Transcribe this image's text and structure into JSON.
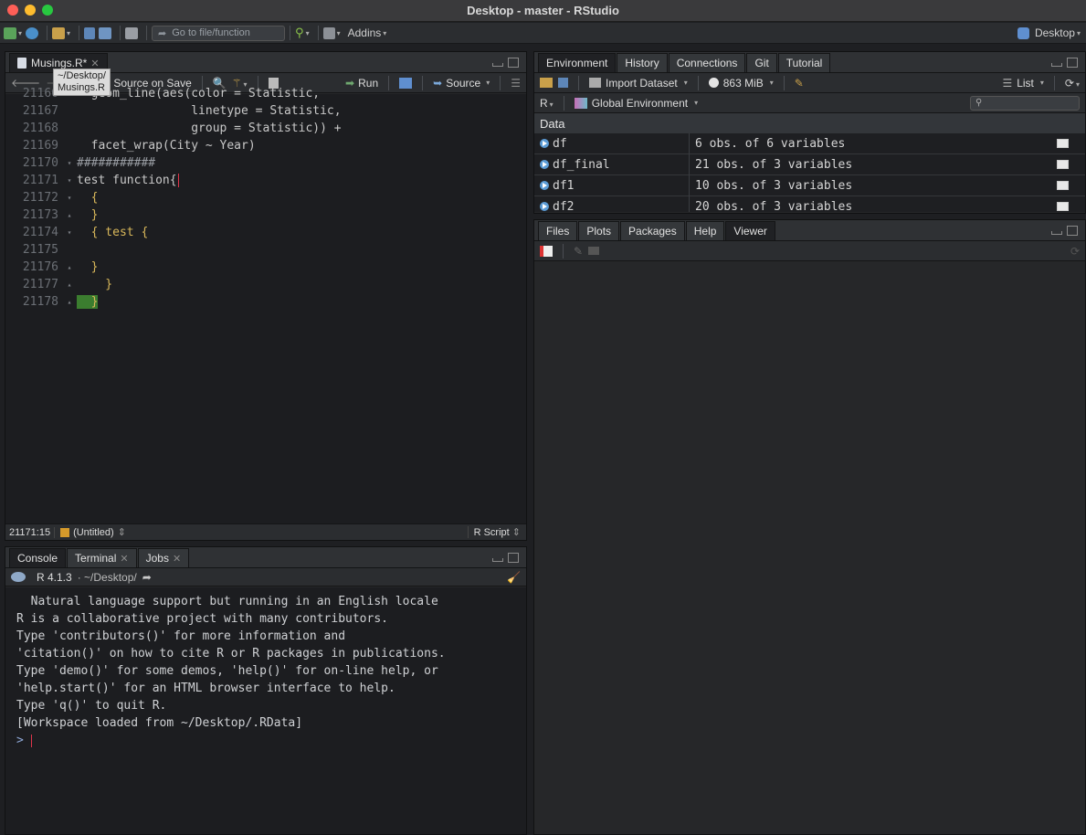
{
  "window": {
    "title": "Desktop - master - RStudio"
  },
  "toolbar": {
    "goto_placeholder": "Go to file/function",
    "addins_label": "Addins",
    "project_label": "Desktop"
  },
  "source_pane": {
    "tab_label": "Musings.R*",
    "tooltip_line1": "~/Desktop/",
    "tooltip_line2": "Musings.R",
    "source_on_save_label": "Source on Save",
    "run_label": "Run",
    "source_label": "Source",
    "lines": [
      {
        "num": "21166",
        "fold": "",
        "text": "  geom_line(aes(color = Statistic,"
      },
      {
        "num": "21167",
        "fold": "",
        "text": "                linetype = Statistic,"
      },
      {
        "num": "21168",
        "fold": "",
        "text": "                group = Statistic)) +"
      },
      {
        "num": "21169",
        "fold": "",
        "text": "  facet_wrap(City ~ Year)"
      },
      {
        "num": "21170",
        "fold": "▾",
        "text": "###########"
      },
      {
        "num": "21171",
        "fold": "▾",
        "text": "test function{"
      },
      {
        "num": "21172",
        "fold": "▾",
        "text": "  {"
      },
      {
        "num": "21173",
        "fold": "▴",
        "text": "  }"
      },
      {
        "num": "21174",
        "fold": "▾",
        "text": "  { test {"
      },
      {
        "num": "21175",
        "fold": "",
        "text": ""
      },
      {
        "num": "21176",
        "fold": "▴",
        "text": "  }"
      },
      {
        "num": "21177",
        "fold": "▴",
        "text": "    }"
      },
      {
        "num": "21178",
        "fold": "▴",
        "text": "  }"
      }
    ],
    "status_position": "21171:15",
    "status_scope": "(Untitled)",
    "status_filetype": "R Script"
  },
  "console_pane": {
    "tabs": [
      "Console",
      "Terminal",
      "Jobs"
    ],
    "r_version": "R 4.1.3",
    "path": "· ~/Desktop/",
    "output": [
      "",
      "  Natural language support but running in an English locale",
      "",
      "R is a collaborative project with many contributors.",
      "Type 'contributors()' for more information and",
      "'citation()' on how to cite R or R packages in publications.",
      "",
      "Type 'demo()' for some demos, 'help()' for on-line help, or",
      "'help.start()' for an HTML browser interface to help.",
      "Type 'q()' to quit R.",
      "",
      "[Workspace loaded from ~/Desktop/.RData]",
      ""
    ],
    "prompt": ">"
  },
  "env_pane": {
    "tabs": [
      "Environment",
      "History",
      "Connections",
      "Git",
      "Tutorial"
    ],
    "import_label": "Import Dataset",
    "memory_label": "863 MiB",
    "list_label": "List",
    "lang_label": "R",
    "scope_label": "Global Environment",
    "section_label": "Data",
    "rows": [
      {
        "name": "df",
        "value": "6 obs. of 6 variables"
      },
      {
        "name": "df_final",
        "value": "21 obs. of 3 variables"
      },
      {
        "name": "df1",
        "value": "10 obs. of 3 variables"
      },
      {
        "name": "df2",
        "value": "20 obs. of 3 variables"
      }
    ]
  },
  "files_pane": {
    "tabs": [
      "Files",
      "Plots",
      "Packages",
      "Help",
      "Viewer"
    ]
  }
}
